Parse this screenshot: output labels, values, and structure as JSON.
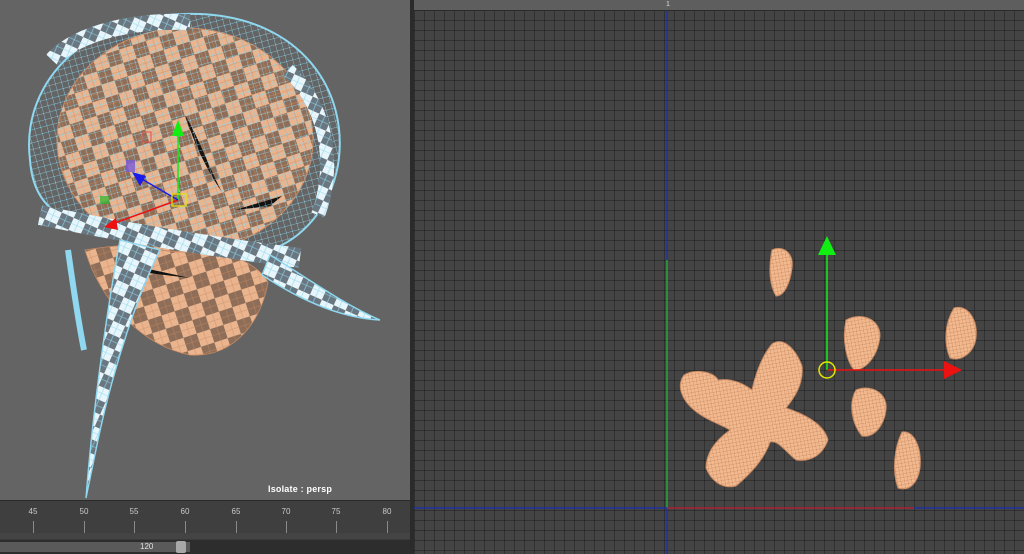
{
  "viewport_persp": {
    "isolate_label": "Isolate : persp",
    "colors": {
      "background": "#646464",
      "wireframe": "#8fd8f0",
      "checker_light": "#e9b48e",
      "checker_dark": "#8e6e58"
    }
  },
  "timeline": {
    "frames": [
      "45",
      "50",
      "55",
      "60",
      "65",
      "70",
      "75",
      "80"
    ],
    "range_end": "120"
  },
  "uv_editor": {
    "top_marker": "1",
    "colors": {
      "shell_fill": "#f2b98f",
      "shell_wire": "#c98a62",
      "axis_blue": "#1a2db5",
      "axis_green": "#22c422",
      "axis_red": "#c81e1e",
      "manip_green": "#11ee11",
      "manip_red": "#ee1111",
      "manip_center": "#e6e600"
    }
  }
}
